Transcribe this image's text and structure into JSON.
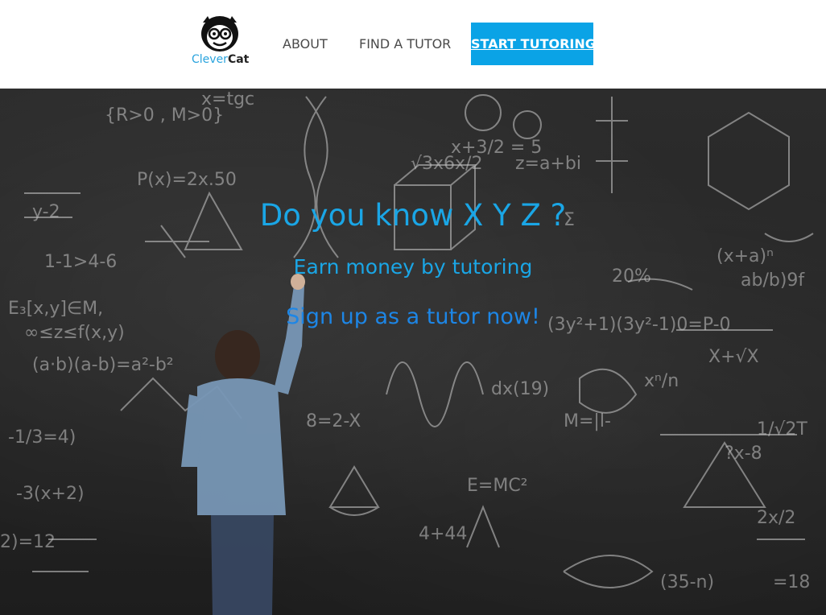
{
  "brand": {
    "name_part1": "Clever",
    "name_part2": "Cat",
    "logo_icon": "monkey-with-glasses-icon"
  },
  "nav": {
    "items": [
      {
        "label": "ABOUT"
      },
      {
        "label": "FIND A TUTOR"
      },
      {
        "label": "START TUTORING"
      }
    ]
  },
  "hero": {
    "title": "Do you know X Y Z ?",
    "subtitle": "Earn money by tutoring",
    "cta": "Sign up as a tutor now!",
    "background": "chalkboard-math-formulas-with-boy-writing"
  },
  "colors": {
    "accent": "#0aa3e6",
    "hero_text": "#1aa6e6",
    "cta_text": "#1d86e6",
    "nav_text": "#4a4a4a"
  }
}
